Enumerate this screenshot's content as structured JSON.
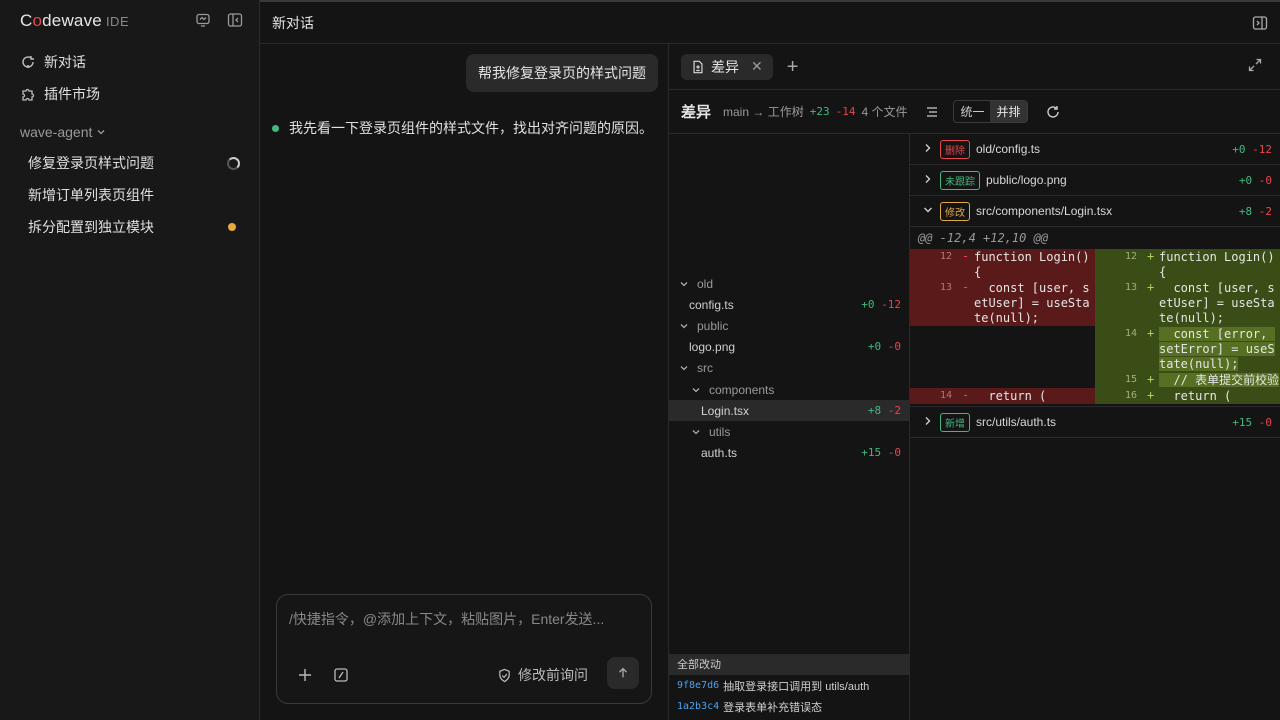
{
  "sidebar": {
    "logo": {
      "pre": "C",
      "o": "o",
      "post": "dewave",
      "suffix": "IDE"
    },
    "nav": [
      {
        "label": "新对话"
      },
      {
        "label": "插件市场"
      }
    ],
    "group": "wave-agent",
    "conversations": [
      {
        "label": "修复登录页样式问题",
        "status": "loading"
      },
      {
        "label": "新增订单列表页组件",
        "status": "none"
      },
      {
        "label": "拆分配置到独立模块",
        "status": "unread"
      }
    ]
  },
  "topbar": {
    "title": "新对话"
  },
  "chat": {
    "user_message": "帮我修复登录页的样式问题",
    "assistant_message": "我先看一下登录页组件的样式文件，找出对齐问题的原因。",
    "composer": {
      "placeholder": "/快捷指令，@添加上下文，粘贴图片，Enter发送...",
      "ask_label": "修改前询问"
    }
  },
  "diff": {
    "tab_label": "差异",
    "header": {
      "title": "差异",
      "branch": "main → 工作树",
      "added": "+23",
      "removed": "-14",
      "file_count": "4 个文件",
      "view_unified": "统一",
      "view_split": "并排"
    },
    "tree": [
      {
        "type": "folder",
        "name": "old",
        "depth": 0
      },
      {
        "type": "file",
        "name": "config.ts",
        "depth": 0,
        "added": "+0",
        "removed": "-12"
      },
      {
        "type": "folder",
        "name": "public",
        "depth": 0
      },
      {
        "type": "file",
        "name": "logo.png",
        "depth": 0,
        "added": "+0",
        "removed": "-0"
      },
      {
        "type": "folder",
        "name": "src",
        "depth": 0
      },
      {
        "type": "folder",
        "name": "components",
        "depth": 1
      },
      {
        "type": "file",
        "name": "Login.tsx",
        "depth": 1,
        "added": "+8",
        "removed": "-2",
        "selected": true
      },
      {
        "type": "folder",
        "name": "utils",
        "depth": 1
      },
      {
        "type": "file",
        "name": "auth.ts",
        "depth": 1,
        "added": "+15",
        "removed": "-0"
      }
    ],
    "commits_header": "全部改动",
    "commits": [
      {
        "hash": "9f8e7d6",
        "message": "抽取登录接口调用到 utils/auth"
      },
      {
        "hash": "1a2b3c4",
        "message": "登录表单补充错误态"
      }
    ],
    "files": [
      {
        "badge": "删除",
        "badge_kind": "del",
        "path": "old/config.ts",
        "added": "+0",
        "removed": "-12",
        "expanded": false
      },
      {
        "badge": "未跟踪",
        "badge_kind": "un",
        "path": "public/logo.png",
        "added": "+0",
        "removed": "-0",
        "expanded": false
      },
      {
        "badge": "修改",
        "badge_kind": "mod",
        "path": "src/components/Login.tsx",
        "added": "+8",
        "removed": "-2",
        "expanded": true
      },
      {
        "badge": "新增",
        "badge_kind": "new",
        "path": "src/utils/auth.ts",
        "added": "+15",
        "removed": "-0",
        "expanded": false
      }
    ],
    "hunk_header": "@@ -12,4 +12,10 @@",
    "rows": [
      {
        "left": {
          "n": "12",
          "s": "-",
          "code": "function Login() {"
        },
        "right": {
          "n": "12",
          "s": "+",
          "code": "function Login() {"
        }
      },
      {
        "left": {
          "n": "13",
          "s": "-",
          "code": "  const [user, setUser] = useState(null);"
        },
        "right": {
          "n": "13",
          "s": "+",
          "code": "  const [user, setUser] = useState(null);"
        }
      },
      {
        "left": null,
        "right": {
          "n": "14",
          "s": "+",
          "code": "  const [error, setError] = useState(null);",
          "hl": true
        }
      },
      {
        "left": null,
        "right": {
          "n": "15",
          "s": "+",
          "code": "  // 表单提交前校验",
          "hl": true
        }
      },
      {
        "left": {
          "n": "14",
          "s": "-",
          "code": "  return ("
        },
        "right": {
          "n": "16",
          "s": "+",
          "code": "  return ("
        }
      }
    ]
  }
}
